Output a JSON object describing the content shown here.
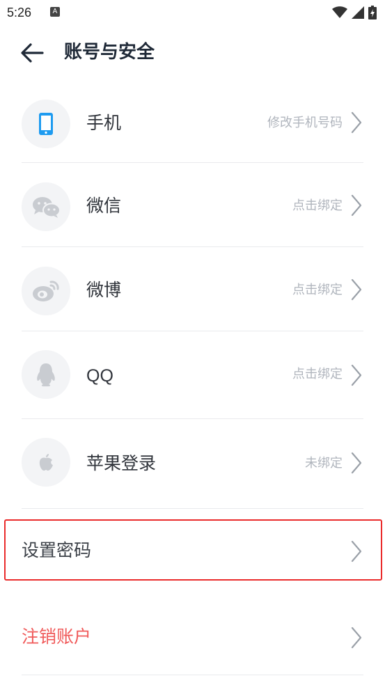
{
  "status_bar": {
    "time": "5:26",
    "a_icon": "A"
  },
  "header": {
    "title": "账号与安全",
    "back_icon": "arrow-left-icon"
  },
  "rows": [
    {
      "label": "手机",
      "value": "修改手机号码",
      "icon": "phone-icon"
    },
    {
      "label": "微信",
      "value": "点击绑定",
      "icon": "wechat-icon"
    },
    {
      "label": "微博",
      "value": "点击绑定",
      "icon": "weibo-icon"
    },
    {
      "label": "QQ",
      "value": "点击绑定",
      "icon": "qq-icon"
    },
    {
      "label": "苹果登录",
      "value": "未绑定",
      "icon": "apple-icon"
    }
  ],
  "actions": {
    "set_password": "设置密码",
    "delete_account": "注销账户"
  },
  "colors": {
    "accent_blue": "#1e9bf0",
    "danger": "#f05a5a",
    "highlight": "#ea2b2b"
  }
}
